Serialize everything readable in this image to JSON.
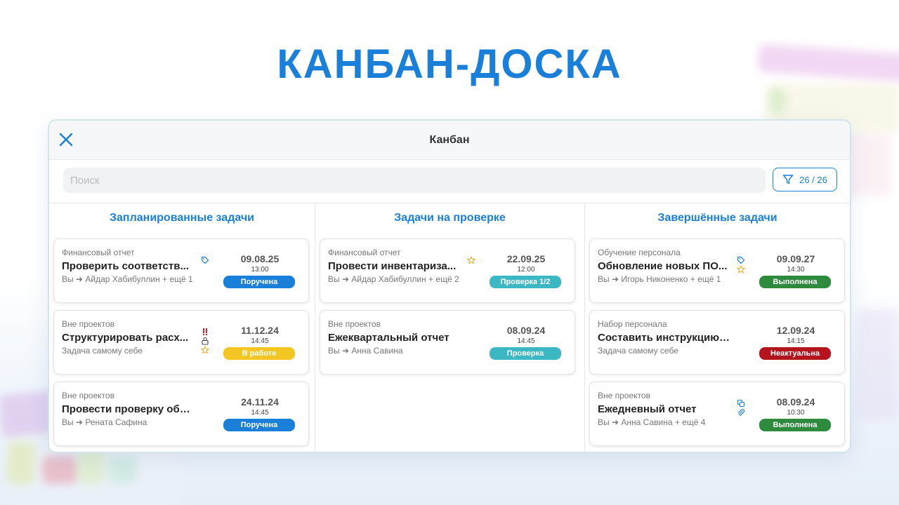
{
  "headline": "КАНБАН-ДОСКА",
  "window": {
    "title": "Канбан",
    "search_placeholder": "Поиск",
    "filter_count": "26 / 26"
  },
  "colors": {
    "accent": "#1a7fd9",
    "status_assigned": "#1a7fd9",
    "status_in_progress": "#f3c623",
    "status_review": "#3cb8c4",
    "status_done": "#2e8b3e",
    "status_irrelevant": "#b3141d"
  },
  "columns": [
    {
      "title": "Запланированные задачи",
      "cards": [
        {
          "project": "Финансовый отчет",
          "task": "Проверить соответств...",
          "from": "Вы",
          "to": "Айдар Хабибуллин + ещё 1",
          "date": "09.08.25",
          "time": "13:00",
          "status": "Поручена",
          "icons": [
            "tag-icon"
          ]
        },
        {
          "project": "Вне проектов",
          "task": "Структурировать расх...",
          "from": "",
          "to": "Задача самому себе",
          "date": "11.12.24",
          "time": "14:45",
          "status": "В работе",
          "icons": [
            "urgent-icon",
            "lock-icon",
            "star-icon"
          ]
        },
        {
          "project": "Вне проектов",
          "task": "Провести проверку обор...",
          "from": "Вы",
          "to": "Рената Сафина",
          "date": "24.11.24",
          "time": "14:45",
          "status": "Поручена",
          "icons": []
        }
      ]
    },
    {
      "title": "Задачи на проверке",
      "cards": [
        {
          "project": "Финансовый отчет",
          "task": "Провести инвентариза...",
          "from": "Вы",
          "to": "Айдар Хабибуллин + ещё 2",
          "date": "22.09.25",
          "time": "12:00",
          "status": "Проверка 1/2",
          "icons": [
            "star-icon"
          ]
        },
        {
          "project": "Вне проектов",
          "task": "Ежеквартальный отчет",
          "from": "Вы",
          "to": "Анна Савина",
          "date": "08.09.24",
          "time": "14:45",
          "status": "Проверка",
          "icons": []
        }
      ]
    },
    {
      "title": "Завершённые задачи",
      "cards": [
        {
          "project": "Обучение персонала",
          "task": "Обновление новых ПО...",
          "from": "Вы",
          "to": "Игорь Никоненко + ещё 1",
          "date": "09.09.27",
          "time": "14:30",
          "status": "Выполнена",
          "icons": [
            "tag-icon",
            "star-icon"
          ]
        },
        {
          "project": "Набор персонала",
          "task": "Составить инструкцию - ...",
          "from": "",
          "to": "Задача самому себе",
          "date": "12.09.24",
          "time": "14:15",
          "status": "Неактуальна",
          "icons": []
        },
        {
          "project": "Вне проектов",
          "task": "Ежедневный отчет",
          "from": "Вы",
          "to": "Анна Савина + ещё 4",
          "date": "08.09.24",
          "time": "10:30",
          "status": "Выполнена",
          "icons": [
            "copy-icon",
            "paperclip-icon"
          ]
        }
      ]
    }
  ]
}
